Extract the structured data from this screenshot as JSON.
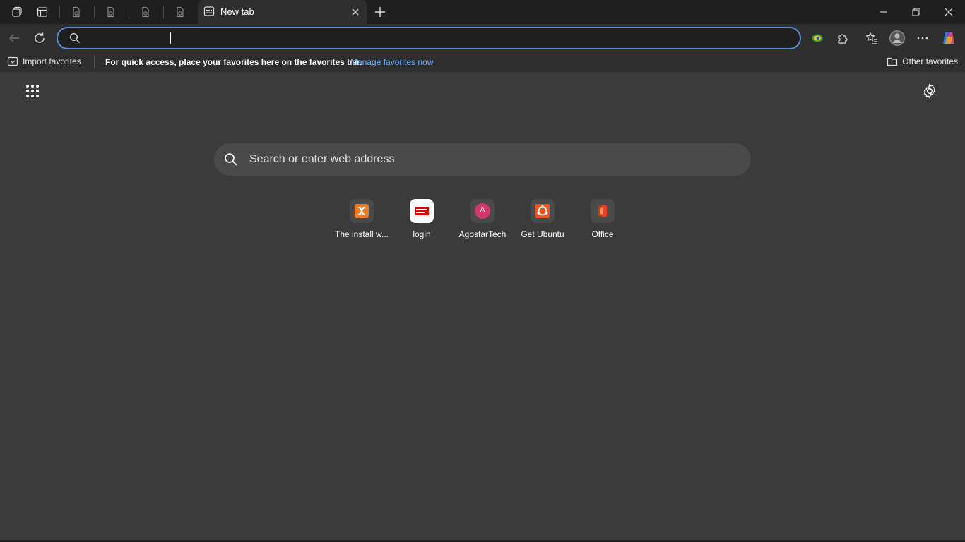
{
  "titlebar": {
    "active_tab_title": "New tab"
  },
  "toolbar": {
    "address_value": "",
    "address_placeholder": ""
  },
  "favorites_bar": {
    "import_label": "Import favorites",
    "message": "For quick access, place your favorites here on the favorites bar.",
    "manage_link": "Manage favorites now",
    "other_label": "Other favorites"
  },
  "newtab": {
    "search_placeholder": "Search or enter web address",
    "tiles": [
      {
        "label": "The install w...",
        "icon": "xampp-icon",
        "color": "#f37a24"
      },
      {
        "label": "login",
        "icon": "airtel-icon",
        "color": "#e60000"
      },
      {
        "label": "AgostarTech",
        "icon": "letter-a-icon",
        "letter": "A",
        "color": "#d3386a"
      },
      {
        "label": "Get Ubuntu",
        "icon": "ubuntu-icon",
        "color": "#e95420"
      },
      {
        "label": "Office",
        "icon": "office-icon",
        "color": "#d83b01"
      }
    ]
  },
  "colors": {
    "accent": "#5a8fdc",
    "link": "#6fb0ff",
    "background": "#3b3b3b",
    "chrome": "#2e2e2e"
  }
}
